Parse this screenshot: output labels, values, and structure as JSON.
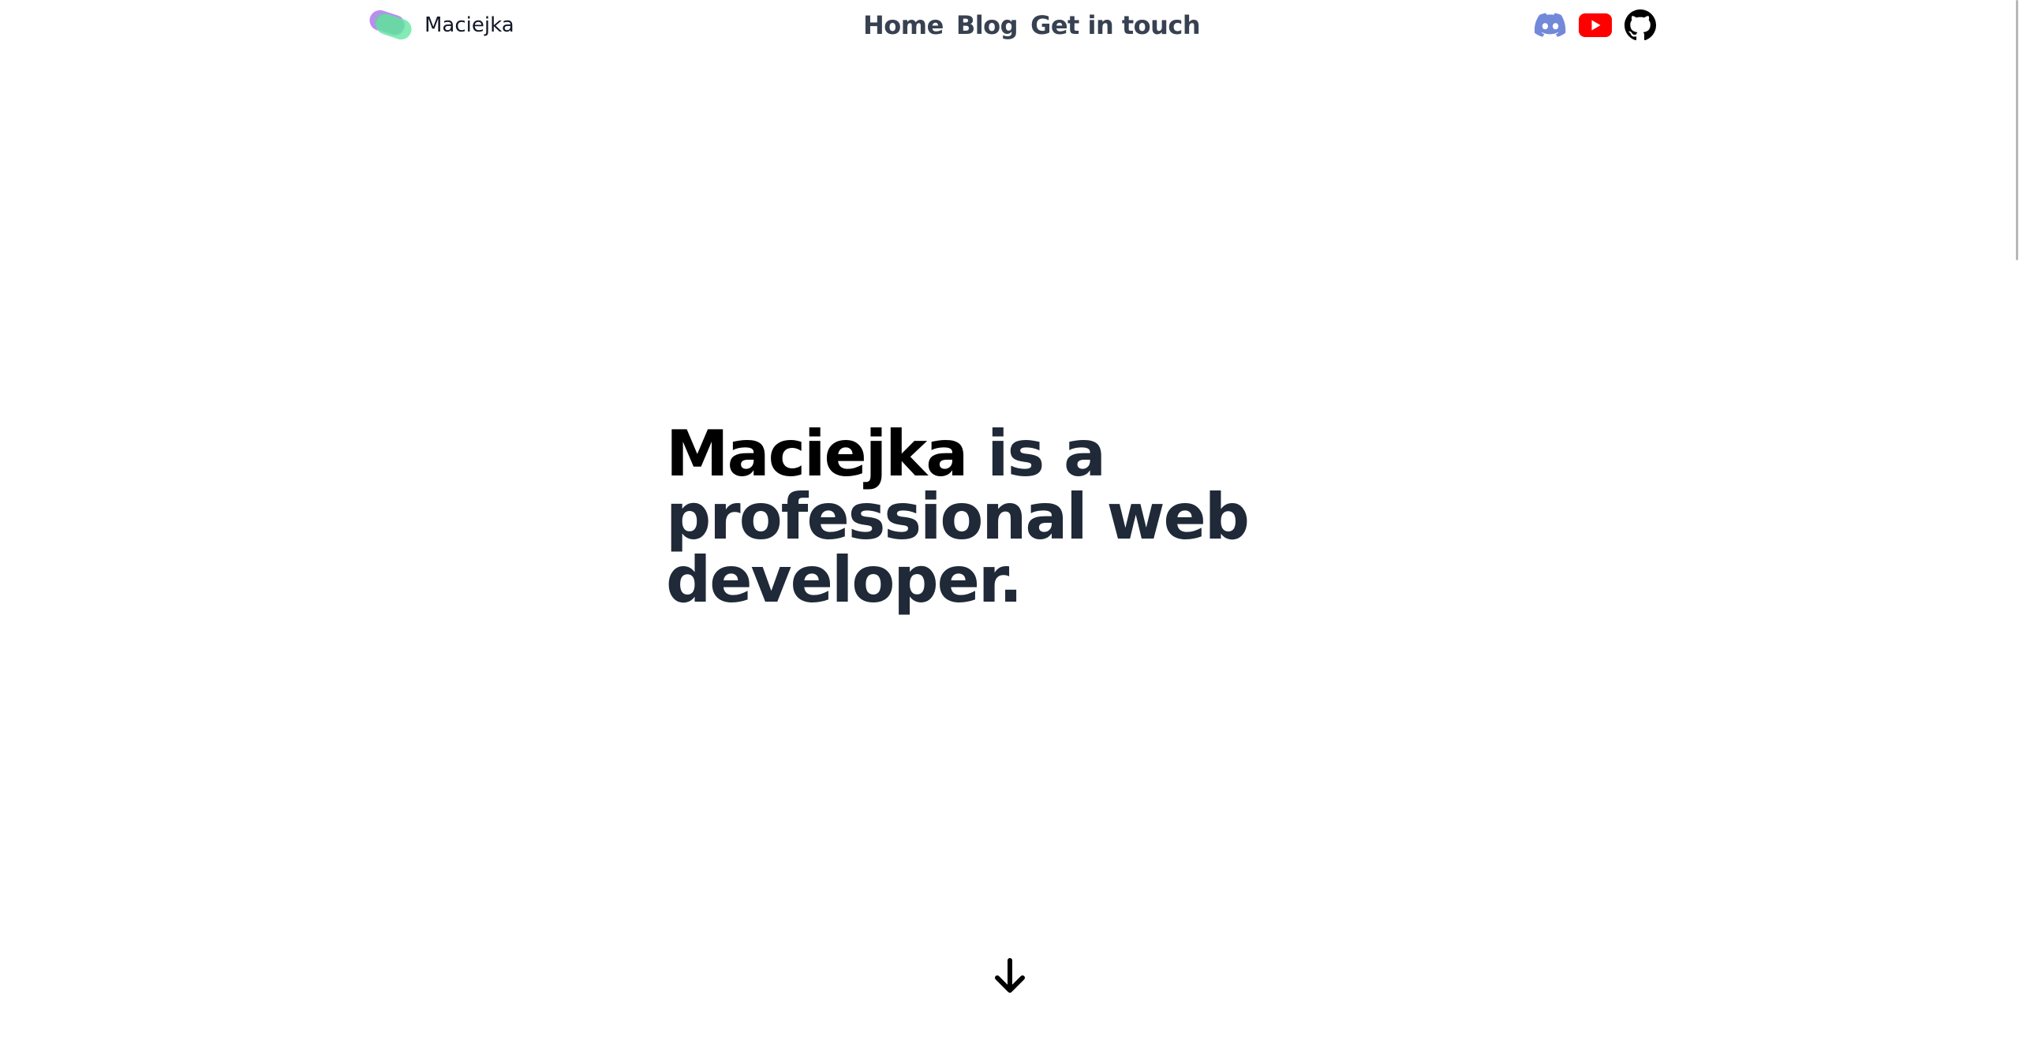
{
  "header": {
    "logo_text": "Maciejka",
    "nav": {
      "home": "Home",
      "blog": "Blog",
      "contact": "Get in touch"
    },
    "social": [
      "discord-icon",
      "youtube-icon",
      "github-icon"
    ]
  },
  "hero": {
    "name": "Maciejka",
    "line1_rest": " is a",
    "line2": "professional web",
    "line3": "developer."
  },
  "icons": {
    "scroll": "arrow-down-icon"
  },
  "colors": {
    "name": "#000000",
    "heading": "#1f2937",
    "nav": "#374151",
    "discord": "#7289da",
    "youtube": "#ff0000",
    "github": "#000000",
    "logo_purple": "#b67ef2",
    "logo_green": "#6ee7a8"
  }
}
